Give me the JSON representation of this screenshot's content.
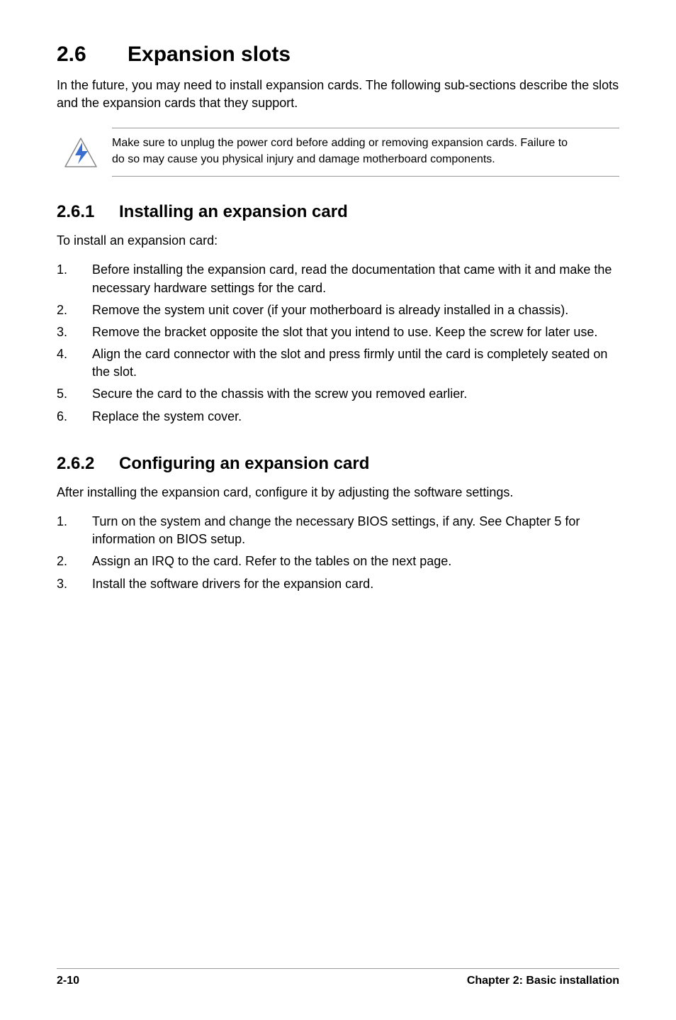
{
  "heading1": {
    "number": "2.6",
    "title": "Expansion slots"
  },
  "intro": "In the future, you may need to install expansion cards. The following sub-sections describe the slots and the expansion cards that they support.",
  "note": "Make sure to unplug the power cord before adding or removing expansion cards. Failure to do so may cause you physical injury and damage motherboard components.",
  "section1": {
    "number": "2.6.1",
    "title": "Installing an expansion card",
    "intro": "To install an expansion card:",
    "items": [
      "Before installing the expansion card, read the documentation that came with it and make the necessary hardware settings for the card.",
      "Remove the system unit cover (if your motherboard is already installed in a chassis).",
      "Remove the bracket opposite the slot that you intend to use. Keep the screw for later use.",
      "Align the card connector with the slot and press firmly until the card is completely seated on the slot.",
      "Secure the card to the chassis with the screw you removed earlier.",
      "Replace the system cover."
    ]
  },
  "section2": {
    "number": "2.6.2",
    "title": "Configuring an expansion card",
    "intro": "After installing the expansion card, configure it by adjusting the software settings.",
    "items": [
      "Turn on the system and change the necessary BIOS settings, if any. See Chapter 5 for information on BIOS setup.",
      "Assign an IRQ to the card. Refer to the tables on the next page.",
      "Install the software drivers for the expansion card."
    ]
  },
  "footer": {
    "page": "2-10",
    "chapter": "Chapter 2: Basic installation"
  }
}
